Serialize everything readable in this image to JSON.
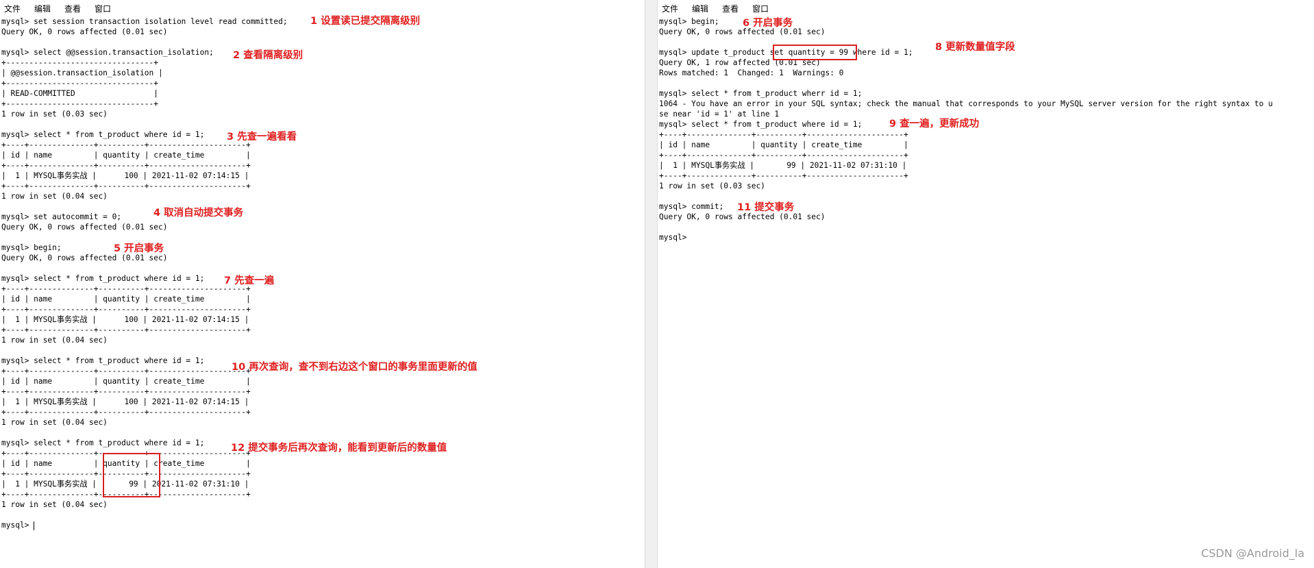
{
  "menu": {
    "file": "文件",
    "edit": "编辑",
    "view": "查看",
    "window": "窗口"
  },
  "left": {
    "lines": [
      "mysql> set session transaction isolation level read committed;",
      "Query OK, 0 rows affected (0.01 sec)",
      "",
      "mysql> select @@session.transaction_isolation;",
      "+--------------------------------+",
      "| @@session.transaction_isolation |",
      "+--------------------------------+",
      "| READ-COMMITTED                 |",
      "+--------------------------------+",
      "1 row in set (0.03 sec)",
      "",
      "mysql> select * from t_product where id = 1;",
      "+----+--------------+----------+---------------------+",
      "| id | name         | quantity | create_time         |",
      "+----+--------------+----------+---------------------+",
      "|  1 | MYSQL事务实战 |      100 | 2021-11-02 07:14:15 |",
      "+----+--------------+----------+---------------------+",
      "1 row in set (0.04 sec)",
      "",
      "mysql> set autocommit = 0;",
      "Query OK, 0 rows affected (0.01 sec)",
      "",
      "mysql> begin;",
      "Query OK, 0 rows affected (0.01 sec)",
      "",
      "mysql> select * from t_product where id = 1;",
      "+----+--------------+----------+---------------------+",
      "| id | name         | quantity | create_time         |",
      "+----+--------------+----------+---------------------+",
      "|  1 | MYSQL事务实战 |      100 | 2021-11-02 07:14:15 |",
      "+----+--------------+----------+---------------------+",
      "1 row in set (0.04 sec)",
      "",
      "mysql> select * from t_product where id = 1;",
      "+----+--------------+----------+---------------------+",
      "| id | name         | quantity | create_time         |",
      "+----+--------------+----------+---------------------+",
      "|  1 | MYSQL事务实战 |      100 | 2021-11-02 07:14:15 |",
      "+----+--------------+----------+---------------------+",
      "1 row in set (0.04 sec)",
      "",
      "mysql> select * from t_product where id = 1;",
      "+----+--------------+----------+---------------------+",
      "| id | name         | quantity | create_time         |",
      "+----+--------------+----------+---------------------+",
      "|  1 | MYSQL事务实战 |       99 | 2021-11-02 07:31:10 |",
      "+----+--------------+----------+---------------------+",
      "1 row in set (0.04 sec)",
      "",
      "mysql> "
    ],
    "annotations": {
      "a1": "1 设置读已提交隔离级别",
      "a2": "2 查看隔离级别",
      "a3": "3 先查一遍看看",
      "a4": "4 取消自动提交事务",
      "a5": "5 开启事务",
      "a7": "7 先查一遍",
      "a10": "10 再次查询，查不到右边这个窗口的事务里面更新的值",
      "a12": "12 提交事务后再次查询，能看到更新后的数量值"
    }
  },
  "right": {
    "lines": [
      "mysql> begin;",
      "Query OK, 0 rows affected (0.01 sec)",
      "",
      "mysql> update t_product set quantity = 99 where id = 1;",
      "Query OK, 1 row affected (0.01 sec)",
      "Rows matched: 1  Changed: 1  Warnings: 0",
      "",
      "mysql> select * from t_product wherr id = 1;",
      "1064 - You have an error in your SQL syntax; check the manual that corresponds to your MySQL server version for the right syntax to u",
      "se near 'id = 1' at line 1",
      "mysql> select * from t_product where id = 1;",
      "+----+--------------+----------+---------------------+",
      "| id | name         | quantity | create_time         |",
      "+----+--------------+----------+---------------------+",
      "|  1 | MYSQL事务实战 |       99 | 2021-11-02 07:31:10 |",
      "+----+--------------+----------+---------------------+",
      "1 row in set (0.03 sec)",
      "",
      "mysql> commit;",
      "Query OK, 0 rows affected (0.01 sec)",
      "",
      "mysql> "
    ],
    "annotations": {
      "a6": "6 开启事务",
      "a8": "8 更新数量值字段",
      "a9": "9 查一遍，更新成功",
      "a11": "11 提交事务"
    }
  },
  "watermark": "CSDN @Android_la",
  "colors": {
    "annotation": "#e02020",
    "highlight_box": "#d81e1e"
  }
}
